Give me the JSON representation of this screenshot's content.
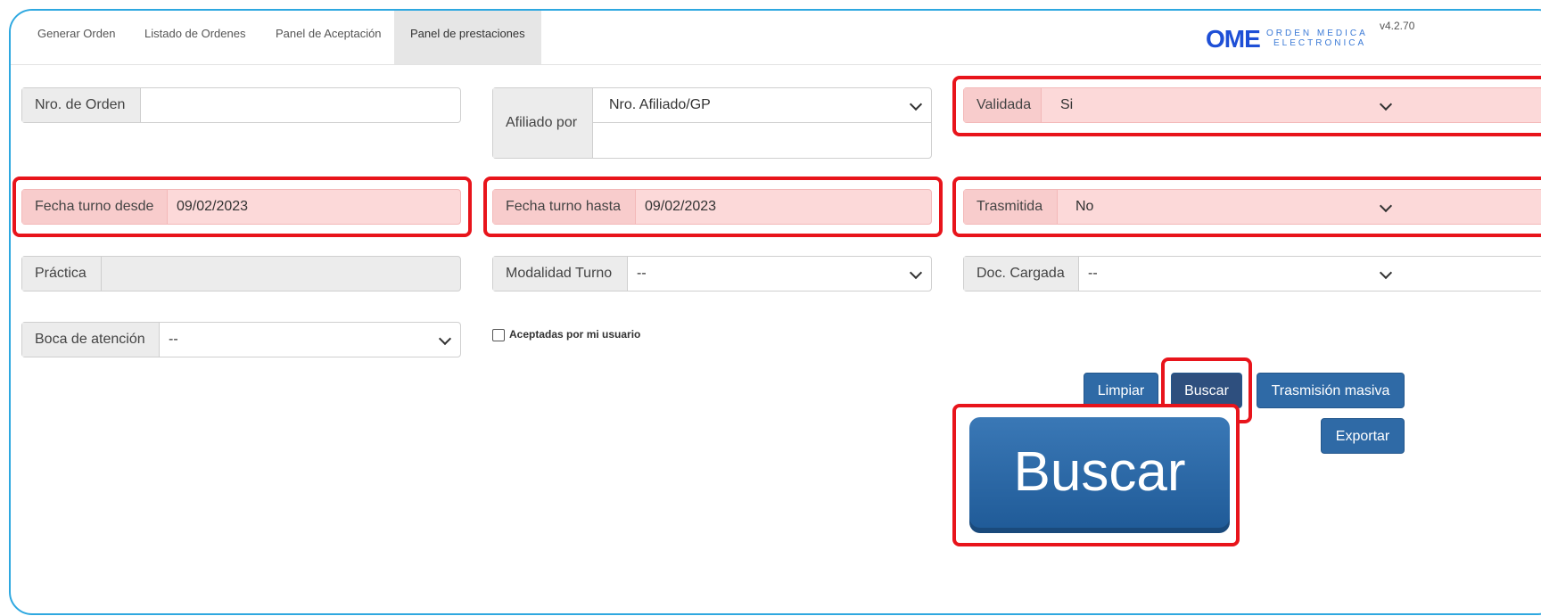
{
  "tabs": [
    {
      "label": "Generar Orden"
    },
    {
      "label": "Listado de Ordenes"
    },
    {
      "label": "Panel de Aceptación"
    },
    {
      "label": "Panel de prestaciones"
    }
  ],
  "brand": {
    "name": "OME",
    "sub_line1": "ORDEN MEDICA",
    "sub_line2": "ELECTRONICA",
    "version": "v4.2.70"
  },
  "filters": {
    "nro_orden": {
      "label": "Nro. de Orden",
      "value": ""
    },
    "afiliado": {
      "label": "Afiliado por",
      "selected": "Nro. Afiliado/GP",
      "value": ""
    },
    "validada": {
      "label": "Validada",
      "selected": "Si"
    },
    "fecha_desde": {
      "label": "Fecha turno desde",
      "value": "09/02/2023"
    },
    "fecha_hasta": {
      "label": "Fecha turno hasta",
      "value": "09/02/2023"
    },
    "trasmitida": {
      "label": "Trasmitida",
      "selected": "No"
    },
    "practica": {
      "label": "Práctica",
      "value": ""
    },
    "modalidad": {
      "label": "Modalidad Turno",
      "selected": "--"
    },
    "doc_cargada": {
      "label": "Doc. Cargada",
      "selected": "--"
    },
    "boca": {
      "label": "Boca de atención",
      "selected": "--"
    },
    "aceptadas": {
      "label": "Aceptadas por mi usuario",
      "checked": false
    }
  },
  "actions": {
    "limpiar": "Limpiar",
    "buscar": "Buscar",
    "trasmision": "Trasmisión masiva",
    "exportar": "Exportar"
  },
  "callout": {
    "label": "Buscar"
  },
  "colors": {
    "primary": "#2f6aa6",
    "highlight": "#e8141b",
    "tint": "#fcd9d9",
    "frame": "#2ea8e0"
  }
}
